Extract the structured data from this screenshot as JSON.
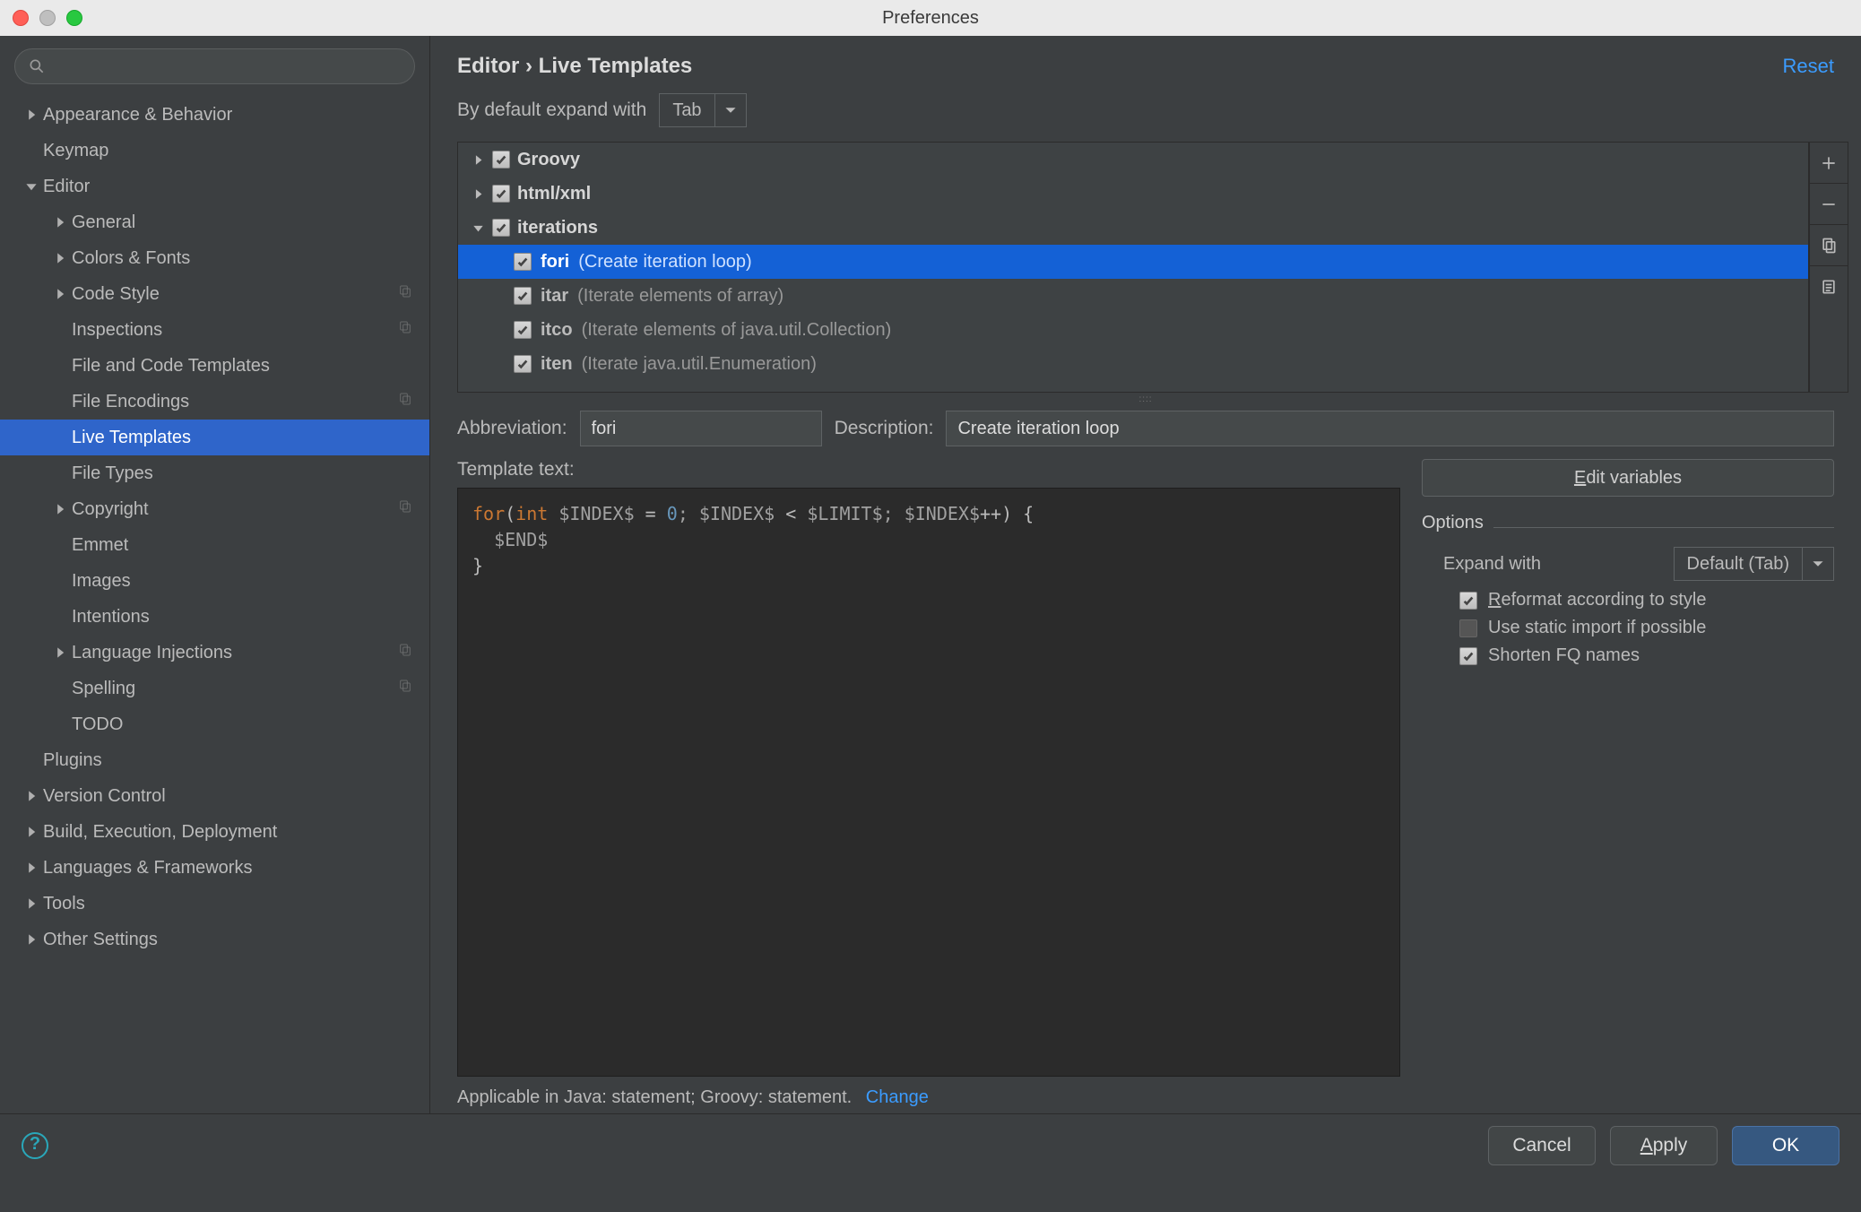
{
  "window": {
    "title": "Preferences"
  },
  "sidebar": {
    "search_placeholder": "",
    "items": [
      {
        "label": "Appearance & Behavior",
        "level": 0,
        "expandable": true,
        "expanded": false
      },
      {
        "label": "Keymap",
        "level": 0,
        "expandable": false
      },
      {
        "label": "Editor",
        "level": 0,
        "expandable": true,
        "expanded": true
      },
      {
        "label": "General",
        "level": 1,
        "expandable": true,
        "expanded": false
      },
      {
        "label": "Colors & Fonts",
        "level": 1,
        "expandable": true,
        "expanded": false
      },
      {
        "label": "Code Style",
        "level": 1,
        "expandable": true,
        "expanded": false,
        "trailing": true
      },
      {
        "label": "Inspections",
        "level": 1,
        "expandable": false,
        "trailing": true
      },
      {
        "label": "File and Code Templates",
        "level": 1,
        "expandable": false
      },
      {
        "label": "File Encodings",
        "level": 1,
        "expandable": false,
        "trailing": true
      },
      {
        "label": "Live Templates",
        "level": 1,
        "expandable": false,
        "selected": true
      },
      {
        "label": "File Types",
        "level": 1,
        "expandable": false
      },
      {
        "label": "Copyright",
        "level": 1,
        "expandable": true,
        "expanded": false,
        "trailing": true
      },
      {
        "label": "Emmet",
        "level": 1,
        "expandable": false
      },
      {
        "label": "Images",
        "level": 1,
        "expandable": false
      },
      {
        "label": "Intentions",
        "level": 1,
        "expandable": false
      },
      {
        "label": "Language Injections",
        "level": 1,
        "expandable": true,
        "expanded": false,
        "trailing": true
      },
      {
        "label": "Spelling",
        "level": 1,
        "expandable": false,
        "trailing": true
      },
      {
        "label": "TODO",
        "level": 1,
        "expandable": false
      },
      {
        "label": "Plugins",
        "level": 0,
        "expandable": false
      },
      {
        "label": "Version Control",
        "level": 0,
        "expandable": true,
        "expanded": false
      },
      {
        "label": "Build, Execution, Deployment",
        "level": 0,
        "expandable": true,
        "expanded": false
      },
      {
        "label": "Languages & Frameworks",
        "level": 0,
        "expandable": true,
        "expanded": false
      },
      {
        "label": "Tools",
        "level": 0,
        "expandable": true,
        "expanded": false
      },
      {
        "label": "Other Settings",
        "level": 0,
        "expandable": true,
        "expanded": false
      }
    ]
  },
  "main": {
    "breadcrumb": "Editor › Live Templates",
    "reset": "Reset",
    "default_expand_label": "By default expand with",
    "default_expand_value": "Tab",
    "groups": [
      {
        "name": "Groovy",
        "expanded": false,
        "checked": true
      },
      {
        "name": "html/xml",
        "expanded": false,
        "checked": true
      },
      {
        "name": "iterations",
        "expanded": true,
        "checked": true,
        "items": [
          {
            "abbr": "fori",
            "desc": "(Create iteration loop)",
            "checked": true,
            "selected": true
          },
          {
            "abbr": "itar",
            "desc": "(Iterate elements of array)",
            "checked": true
          },
          {
            "abbr": "itco",
            "desc": "(Iterate elements of java.util.Collection)",
            "checked": true
          },
          {
            "abbr": "iten",
            "desc": "(Iterate java.util.Enumeration)",
            "checked": true
          }
        ]
      }
    ],
    "abbr_label": "Abbreviation:",
    "abbr_value": "fori",
    "desc_label": "Description:",
    "desc_value": "Create iteration loop",
    "tt_label": "Template text:",
    "template_code_lines": [
      {
        "t": "for",
        "c": "kw"
      },
      {
        "t": "(",
        "c": "txt"
      },
      {
        "t": "int",
        "c": "kw"
      },
      {
        "t": " $INDEX$ ",
        "c": "var"
      },
      {
        "t": "= ",
        "c": "txt"
      },
      {
        "t": "0",
        "c": "num"
      },
      {
        "t": "; $INDEX$ ",
        "c": "var"
      },
      {
        "t": "<",
        "c": "txt"
      },
      {
        "t": " $LIMIT$",
        "c": "var"
      },
      {
        "t": "; $INDEX$",
        "c": "var"
      },
      {
        "t": "++) {",
        "c": "txt"
      },
      {
        "t": "\n  $END$",
        "c": "var"
      },
      {
        "t": "\n}",
        "c": "txt"
      }
    ],
    "edit_vars_label": "Edit variables",
    "options_title": "Options",
    "expand_with_label": "Expand with",
    "expand_with_value": "Default (Tab)",
    "opt_reformat": {
      "label": "Reformat according to style",
      "checked": true
    },
    "opt_static": {
      "label": "Use static import if possible",
      "checked": false
    },
    "opt_shorten": {
      "label": "Shorten FQ names",
      "checked": true
    },
    "applicable_text": "Applicable in Java: statement; Groovy: statement.",
    "change_label": "Change"
  },
  "footer": {
    "cancel": "Cancel",
    "apply": "Apply",
    "ok": "OK"
  }
}
